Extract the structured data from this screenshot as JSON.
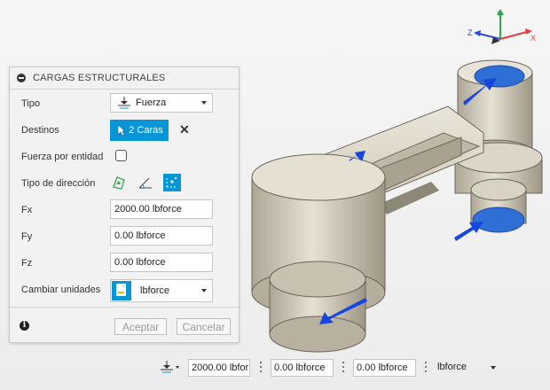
{
  "panel": {
    "title": "CARGAS ESTRUCTURALES",
    "rows": {
      "tipo": {
        "label": "Tipo",
        "value": "Fuerza"
      },
      "destinos": {
        "label": "Destinos",
        "button": "2 Caras"
      },
      "fuerza_por_entidad": {
        "label": "Fuerza por entidad",
        "checked": false
      },
      "tipo_direccion": {
        "label": "Tipo de dirección",
        "selected_index": 2
      },
      "fx": {
        "label": "Fx",
        "value": "2000.00 lbforce"
      },
      "fy": {
        "label": "Fy",
        "value": "0.00 lbforce"
      },
      "fz": {
        "label": "Fz",
        "value": "0.00 lbforce"
      },
      "cambiar_unidades": {
        "label": "Cambiar unidades",
        "value": "lbforce"
      }
    },
    "buttons": {
      "ok": "Aceptar",
      "cancel": "Cancelar"
    }
  },
  "toolbar": {
    "fx": "2000.00 lbfor",
    "fy": "0.00 lbforce",
    "fz": "0.00 lbforce",
    "units": "lbforce"
  },
  "viewcube": {
    "x": "X",
    "y": "Y",
    "z": "Z"
  },
  "colors": {
    "accent": "#0696d7",
    "arrow": "#1546e0",
    "part": "#d8d2c4"
  }
}
